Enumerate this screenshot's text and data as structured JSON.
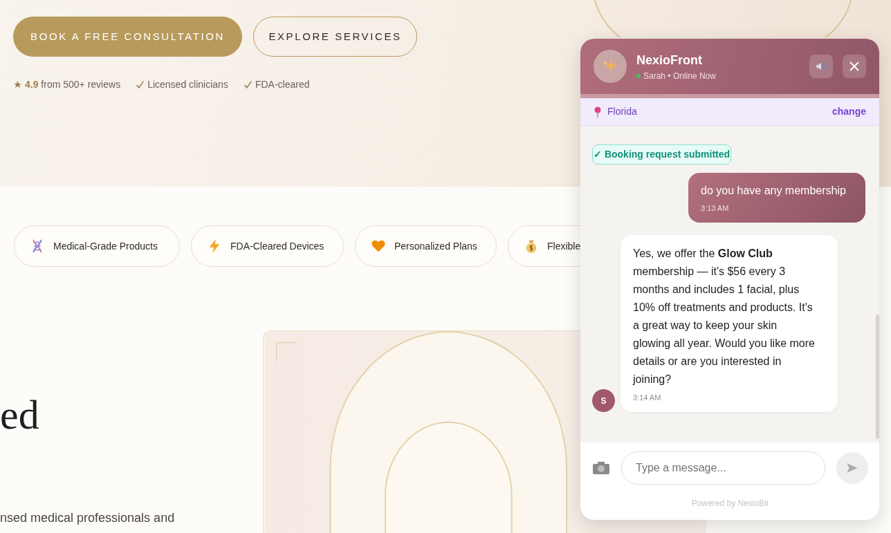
{
  "hero": {
    "buttons": [
      {
        "label": "BOOK A FREE CONSULTATION",
        "kind": "primary"
      },
      {
        "label": "EXPLORE SERVICES",
        "kind": "outline"
      }
    ],
    "trust": [
      {
        "kind": "rating",
        "value": "4.9",
        "text": "from 500+ reviews"
      },
      {
        "kind": "check",
        "text": "Licensed clinicians"
      },
      {
        "kind": "check",
        "text": "FDA-cleared"
      }
    ]
  },
  "features": [
    {
      "kind": "dna",
      "label": "Medical-Grade Products"
    },
    {
      "kind": "bolt",
      "label": "FDA-Cleared Devices"
    },
    {
      "kind": "heart",
      "label": "Personalized Plans"
    },
    {
      "kind": "money",
      "label": "Flexible"
    }
  ],
  "heading_fragment": "ed",
  "paragraph_fragment": "nsed medical professionals and",
  "chat": {
    "title": "NexioFront",
    "agent": "Sarah • Online Now",
    "online": true,
    "location": "Florida",
    "change_link": "change",
    "messages": [
      {
        "kind": "status",
        "text": "✓ Booking request submitted"
      },
      {
        "kind": "user",
        "text": "do you have any membership",
        "time": "3:13 AM"
      },
      {
        "kind": "bot",
        "avatar": "S",
        "text": "Yes, we offer the **Glow Club** membership — it's $56 every 3 months and includes 1 facial, plus 10% off treatments and products. It's a great way to keep your skin glowing all year. Would you like more details or are you interested in joining?",
        "time": "3:14 AM"
      }
    ],
    "input": {
      "placeholder": "Type a message..."
    },
    "footer": "Powered by NexioBit"
  }
}
